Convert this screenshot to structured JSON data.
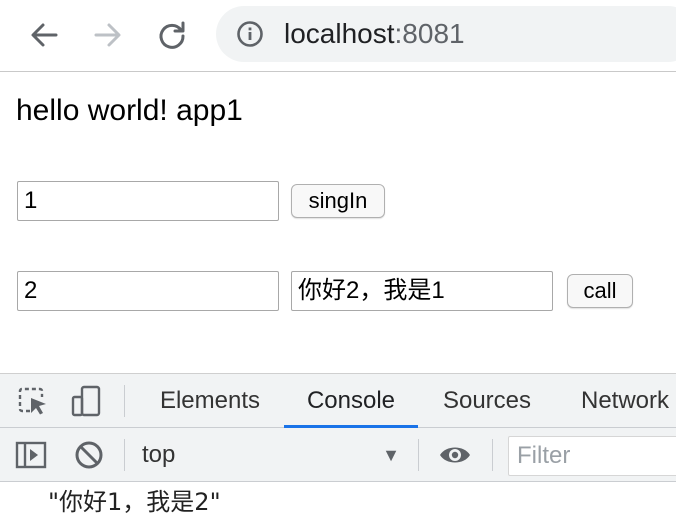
{
  "browser": {
    "url_host": "localhost",
    "url_port": ":8081",
    "icons": {
      "back": "arrow-left-icon",
      "forward": "arrow-right-icon",
      "reload": "reload-icon",
      "site_info": "info-icon"
    }
  },
  "page": {
    "heading": "hello world! app1",
    "row1": {
      "input_value": "1",
      "button_label": "singIn"
    },
    "row2": {
      "input_value": "2",
      "message_value": "你好2，我是1",
      "button_label": "call"
    }
  },
  "devtools": {
    "tabs": [
      "Elements",
      "Console",
      "Sources",
      "Network"
    ],
    "active_tab": "Console",
    "context": "top",
    "filter_placeholder": "Filter",
    "console_output": "\"你好1，我是2\"",
    "accent_color": "#1a73e8",
    "icons": {
      "inspect": "inspect-element-icon",
      "device": "device-toolbar-icon",
      "sidebar": "show-sidebar-icon",
      "clear": "clear-console-icon",
      "live_expression": "eye-icon"
    }
  }
}
